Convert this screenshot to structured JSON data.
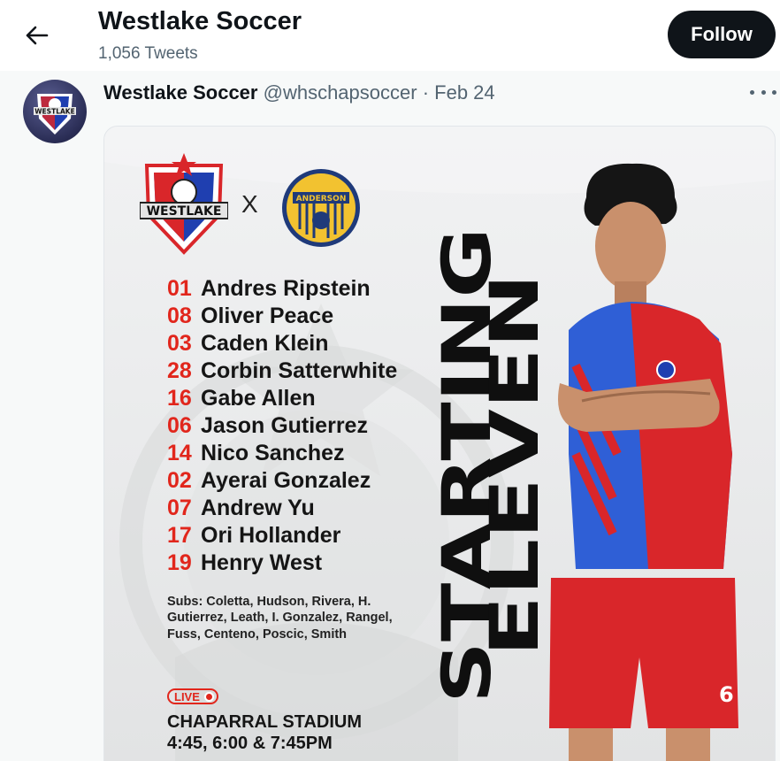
{
  "header": {
    "title": "Westlake Soccer",
    "tweet_count": "1,056 Tweets",
    "follow_label": "Follow",
    "back_icon": "arrow-left-icon"
  },
  "tweet": {
    "author_name": "Westlake Soccer",
    "handle": "@whschapsoccer",
    "separator": "·",
    "date": "Feb 24",
    "more_icon": "ellipsis-icon"
  },
  "graphic": {
    "home_crest_text": "WESTLAKE",
    "vs_text": "X",
    "away_crest_text": "ANDERSON",
    "roster": [
      {
        "num": "01",
        "name": "Andres Ripstein"
      },
      {
        "num": "08",
        "name": "Oliver Peace"
      },
      {
        "num": "03",
        "name": "Caden Klein"
      },
      {
        "num": "28",
        "name": "Corbin Satterwhite"
      },
      {
        "num": "16",
        "name": "Gabe Allen"
      },
      {
        "num": "06",
        "name": "Jason Gutierrez"
      },
      {
        "num": "14",
        "name": "Nico Sanchez"
      },
      {
        "num": "02",
        "name": "Ayerai Gonzalez"
      },
      {
        "num": "07",
        "name": "Andrew Yu"
      },
      {
        "num": "17",
        "name": "Ori Hollander"
      },
      {
        "num": "19",
        "name": "Henry West"
      }
    ],
    "subs": "Subs: Coletta, Hudson, Rivera, H. Gutierrez, Leath, I. Gonzalez, Rangel, Fuss, Centeno, Poscic, Smith",
    "live_label": "LIVE",
    "venue": "CHAPARRAL STADIUM",
    "times": "4:45, 6:00 & 7:45PM",
    "title_line1": "STARTING",
    "title_line2": "ELEVEN",
    "jersey_number": "6",
    "colors": {
      "accent_red": "#e1261c",
      "jersey_blue": "#2f5fd6",
      "jersey_red": "#d9262a",
      "anderson_gold": "#f2c230",
      "anderson_navy": "#1f3a7a"
    }
  }
}
